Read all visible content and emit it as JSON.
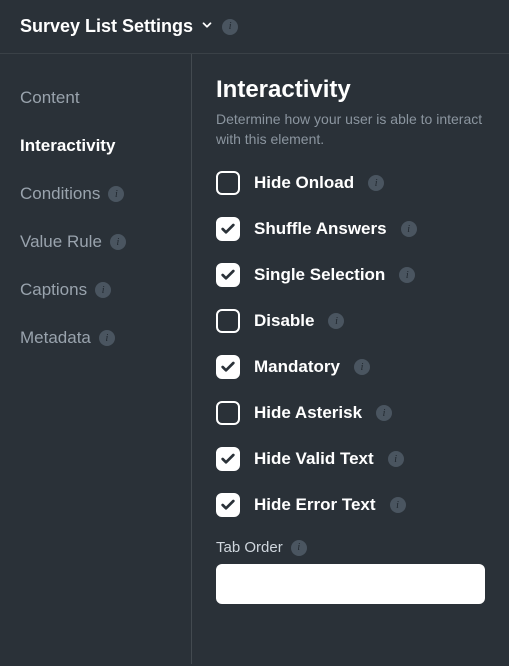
{
  "header": {
    "title": "Survey List Settings"
  },
  "sidebar": {
    "items": [
      {
        "label": "Content",
        "hasInfo": false,
        "active": false
      },
      {
        "label": "Interactivity",
        "hasInfo": false,
        "active": true
      },
      {
        "label": "Conditions",
        "hasInfo": true,
        "active": false
      },
      {
        "label": "Value Rule",
        "hasInfo": true,
        "active": false
      },
      {
        "label": "Captions",
        "hasInfo": true,
        "active": false
      },
      {
        "label": "Metadata",
        "hasInfo": true,
        "active": false
      }
    ]
  },
  "main": {
    "title": "Interactivity",
    "description": "Determine how your user is able to interact with this element.",
    "options": [
      {
        "label": "Hide Onload",
        "checked": false,
        "info": true
      },
      {
        "label": "Shuffle Answers",
        "checked": true,
        "info": true
      },
      {
        "label": "Single Selection",
        "checked": true,
        "info": true
      },
      {
        "label": "Disable",
        "checked": false,
        "info": true
      },
      {
        "label": "Mandatory",
        "checked": true,
        "info": true
      },
      {
        "label": "Hide Asterisk",
        "checked": false,
        "info": true
      },
      {
        "label": "Hide Valid Text",
        "checked": true,
        "info": true
      },
      {
        "label": "Hide Error Text",
        "checked": true,
        "info": true
      }
    ],
    "tabOrder": {
      "label": "Tab Order",
      "value": ""
    }
  }
}
